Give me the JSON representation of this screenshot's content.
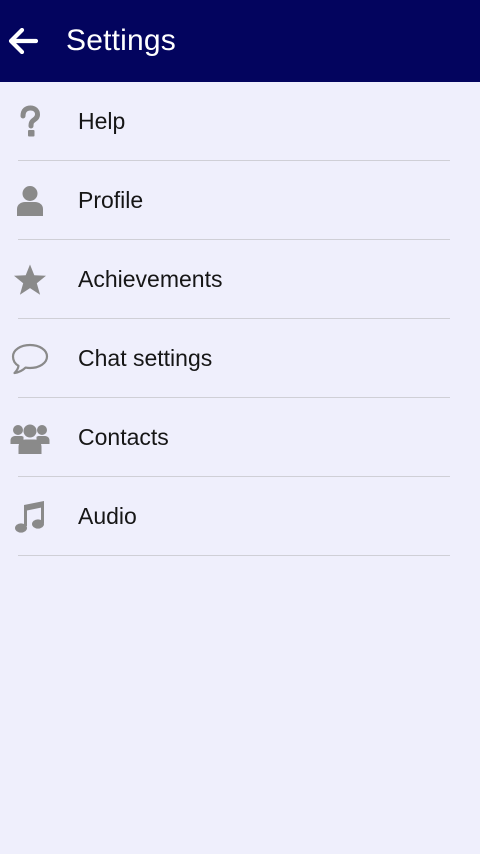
{
  "appbar": {
    "title": "Settings",
    "back_icon": "arrow-left-icon",
    "background": "#03045e"
  },
  "menu": {
    "items": [
      {
        "label": "Help",
        "icon": "question-icon"
      },
      {
        "label": "Profile",
        "icon": "person-icon"
      },
      {
        "label": "Achievements",
        "icon": "star-icon"
      },
      {
        "label": "Chat settings",
        "icon": "speech-bubble-icon"
      },
      {
        "label": "Contacts",
        "icon": "group-icon"
      },
      {
        "label": "Audio",
        "icon": "music-note-icon"
      }
    ]
  },
  "colors": {
    "icon": "#8a8a8a",
    "background": "#efeffc",
    "divider": "#cfcfd6",
    "text": "#161616"
  }
}
